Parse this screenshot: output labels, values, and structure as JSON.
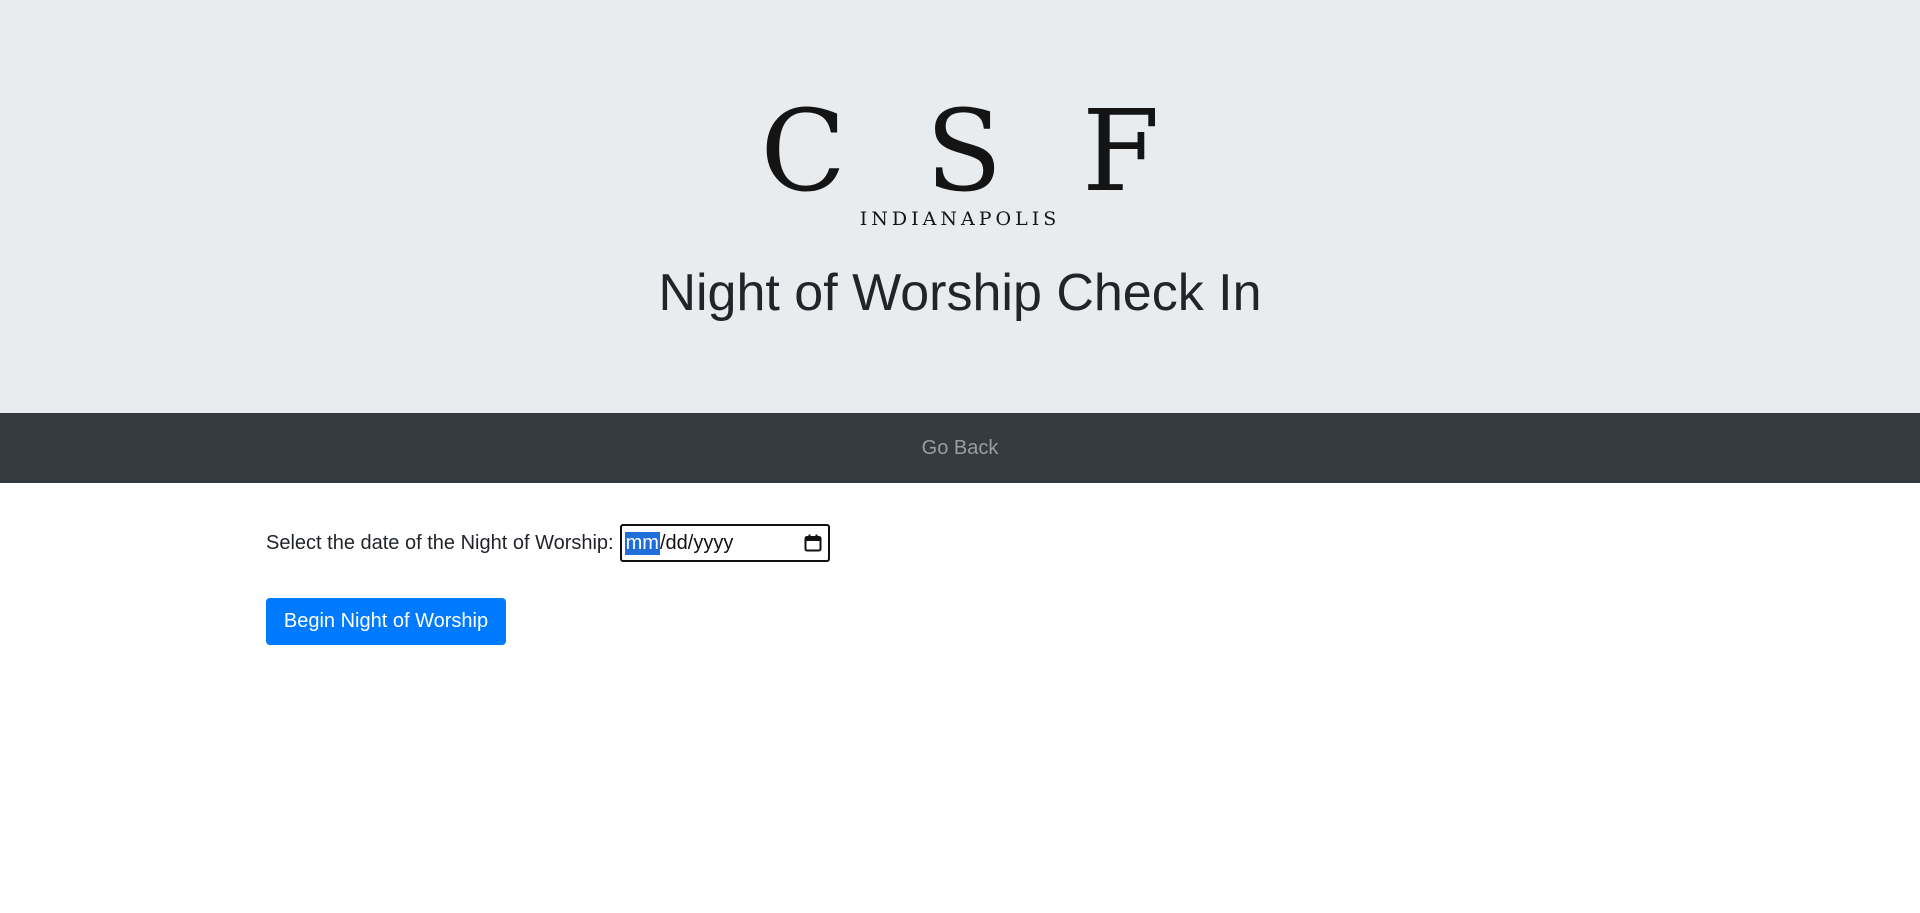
{
  "header": {
    "logo_letters": "C S F",
    "logo_subtitle": "INDIANAPOLIS",
    "title": "Night of Worship Check In"
  },
  "nav": {
    "go_back_label": "Go Back"
  },
  "form": {
    "date_label": "Select the date of the Night of Worship:",
    "date_placeholder": {
      "month": "mm",
      "separator1": "/",
      "day": "dd",
      "separator2": "/",
      "year": "yyyy"
    },
    "date_icon": "calendar-icon",
    "begin_button_label": "Begin Night of Worship"
  },
  "colors": {
    "header_bg": "#e9ecef",
    "navbar_bg": "#343a40",
    "primary_button": "#007bff",
    "selection_highlight": "#1e6fd9"
  }
}
